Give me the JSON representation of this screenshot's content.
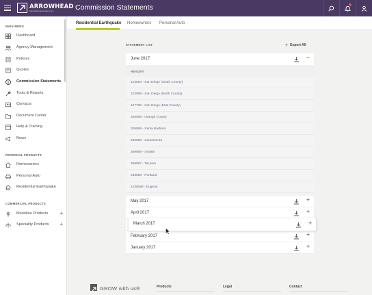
{
  "header": {
    "logo_main": "ARROWHEAD",
    "logo_sub": "General Insurance Agency, Inc.",
    "title": "Commission Statements",
    "icons": [
      "search-icon",
      "bell-icon",
      "user-icon"
    ]
  },
  "sidebar": {
    "main_menu_label": "MAIN MENU",
    "main_items": [
      {
        "label": "Dashboard",
        "icon": "dashboard-icon"
      },
      {
        "label": "Agency Management",
        "icon": "agency-icon"
      },
      {
        "label": "Policies",
        "icon": "policies-icon"
      },
      {
        "label": "Quotes",
        "icon": "quotes-icon"
      },
      {
        "label": "Commission Statements",
        "icon": "dollar-icon",
        "active": true
      },
      {
        "label": "Tools & Reports",
        "icon": "wrench-icon"
      },
      {
        "label": "Contacts",
        "icon": "contacts-icon"
      },
      {
        "label": "Document Center",
        "icon": "folder-icon"
      },
      {
        "label": "Help & Training",
        "icon": "help-icon"
      },
      {
        "label": "News",
        "icon": "megaphone-icon"
      }
    ],
    "personal_label": "PERSONAL PRODUCTS",
    "personal_items": [
      {
        "label": "Homeowners",
        "icon": "home-icon"
      },
      {
        "label": "Personal Auto",
        "icon": "car-icon"
      },
      {
        "label": "Residential Earthquake",
        "icon": "earthquake-icon"
      }
    ],
    "commercial_label": "COMMERCIAL PRODUCTS",
    "commercial_items": [
      {
        "label": "Monoline Products",
        "icon": "monoline-icon"
      },
      {
        "label": "Speciality Products",
        "icon": "speciality-icon"
      }
    ]
  },
  "tabs": [
    {
      "label": "Residential Earthquake",
      "active": true
    },
    {
      "label": "Homeowners",
      "active": false
    },
    {
      "label": "Personal Auto",
      "active": false
    }
  ],
  "main": {
    "list_label": "STATEMENT LIST",
    "export_label": "Export All",
    "open_month": "June 2017",
    "header_label": "HEADER",
    "statements": [
      "123654 - San Diego (South County)",
      "123999 - San Diego (North County)",
      "127768 - San Diego (East County)",
      "326598 - Orange County",
      "326598 - Santa Barbara",
      "546589 - Sacramento",
      "369859 - Seattle",
      "359987 - Tacoma",
      "236598 - Portland",
      "1236598 - Eugene"
    ],
    "months": [
      "May 2017",
      "April 2017",
      "March 2017",
      "February 2017",
      "January 2017"
    ]
  },
  "footer": {
    "grow": "GROW with us®",
    "cols": [
      "Products",
      "Legal",
      "Contact"
    ]
  },
  "colors": {
    "topbar": "#4a3a63",
    "accent": "#b9c72f",
    "badge": "#e5533d"
  }
}
